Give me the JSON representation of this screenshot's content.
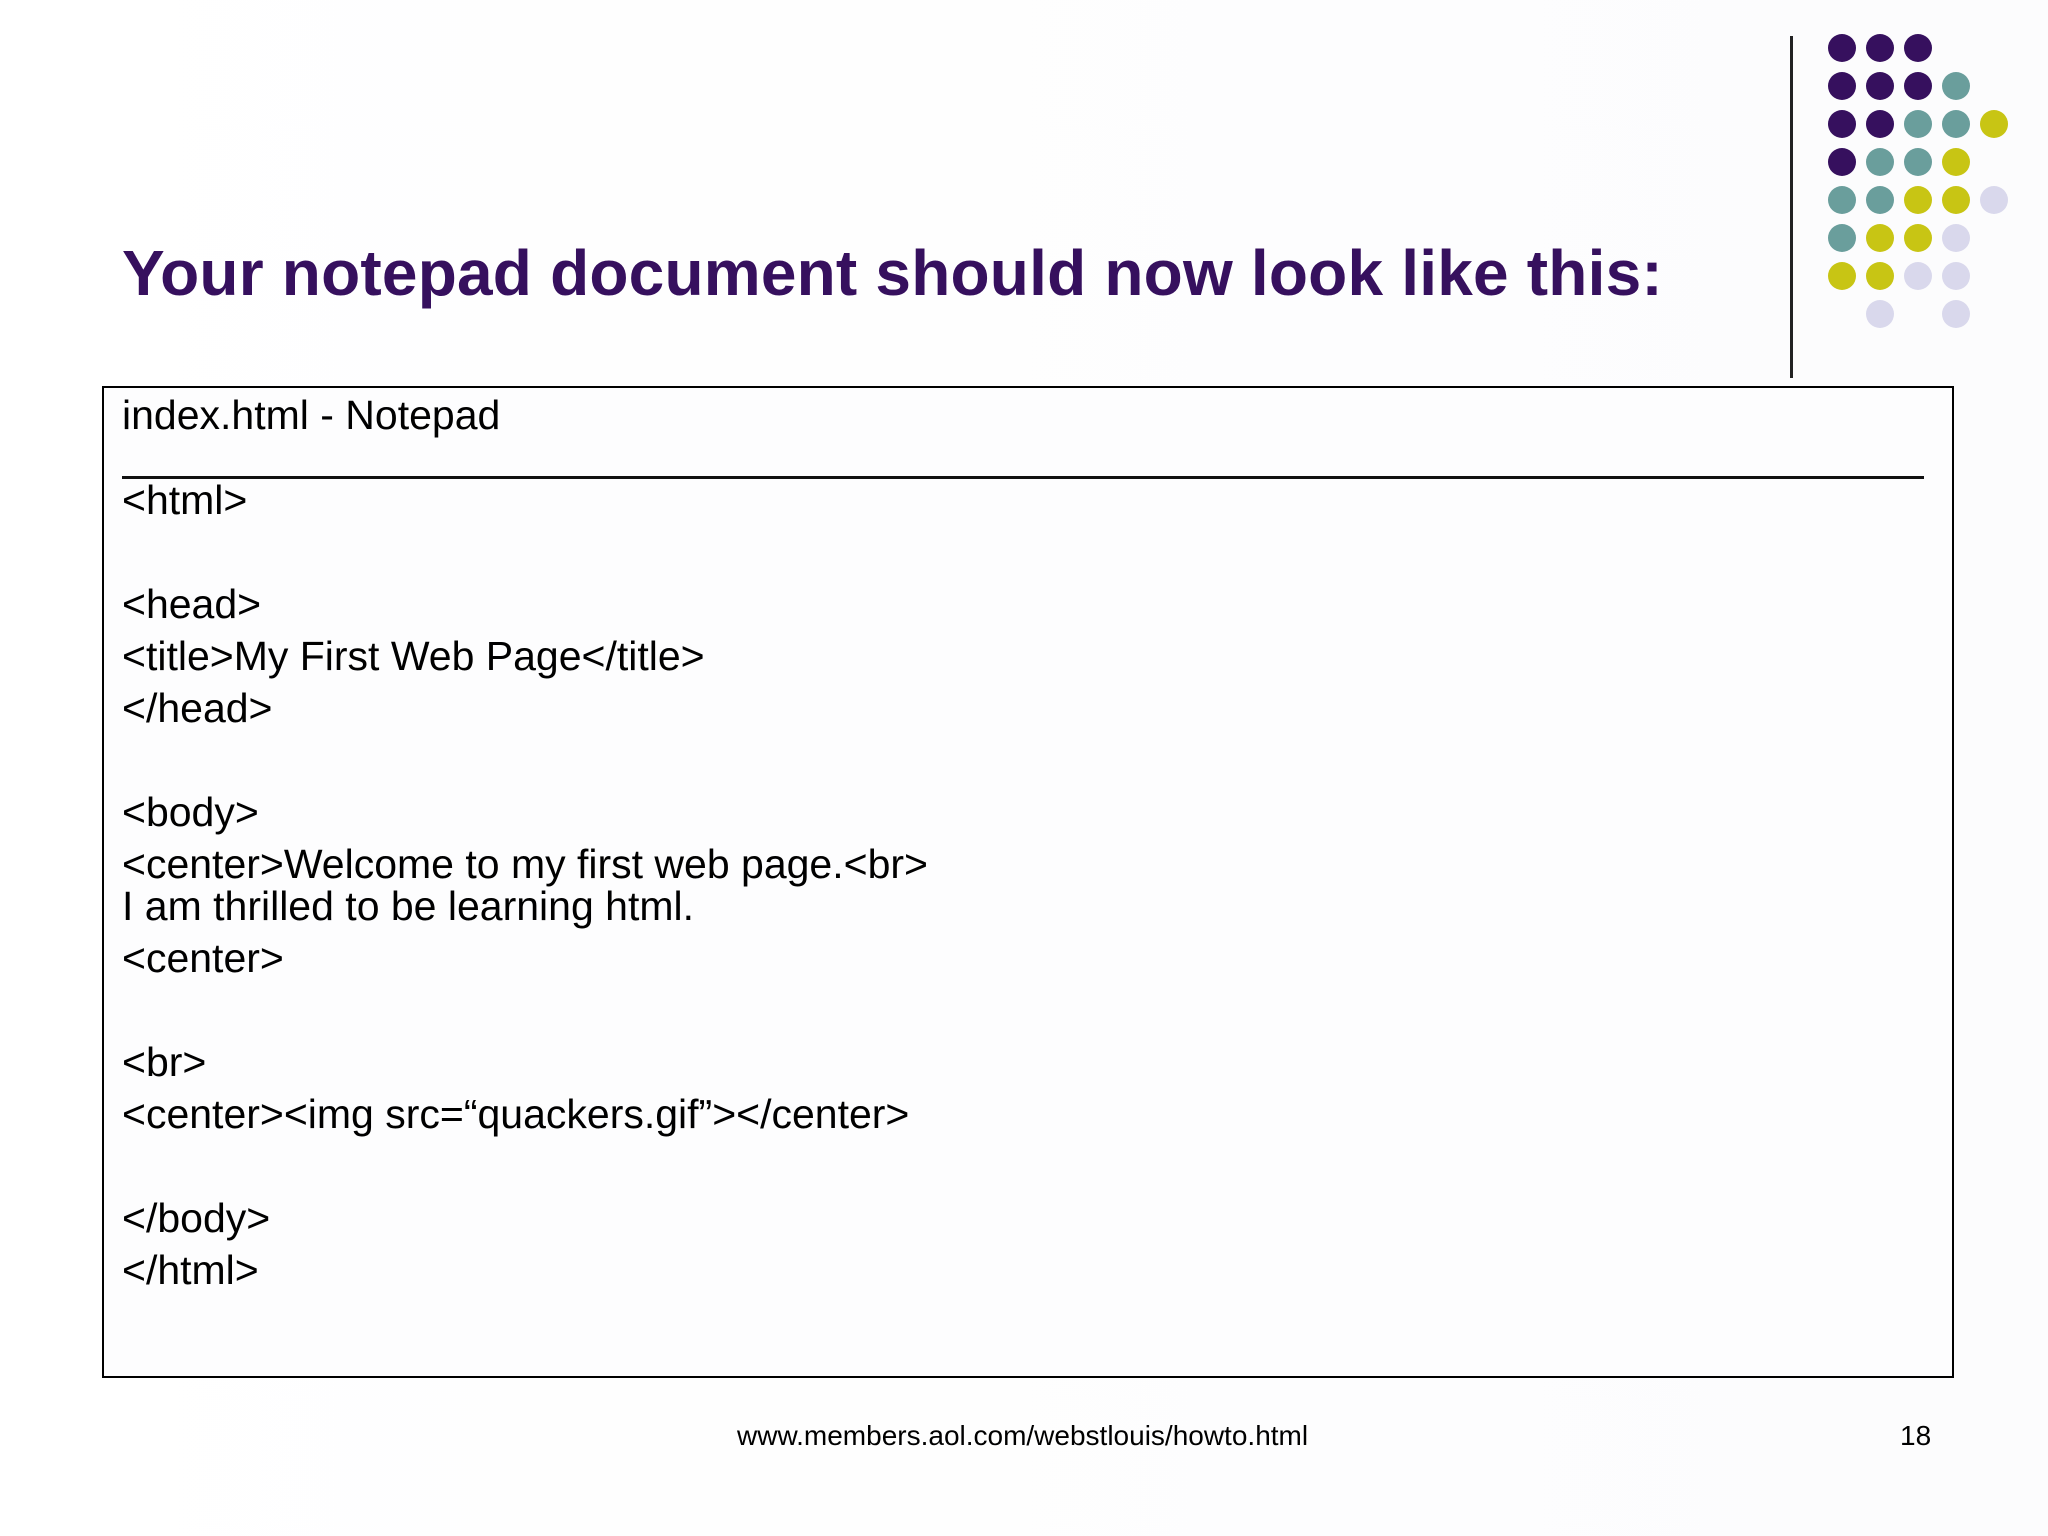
{
  "slide": {
    "title": "Your notepad document should now look like this:",
    "notepad": {
      "window_title": "index.html - Notepad",
      "lines": [
        "<html>",
        "",
        "<head>",
        "<title>My First Web Page</title>",
        "</head>",
        "",
        "<body>",
        "<center>Welcome to my first web page.<br>",
        "I am thrilled to be learning html.",
        "<center>",
        "",
        "<br>",
        "<center><img src=“quackers.gif”></center>",
        "",
        "</body>",
        "</html>"
      ]
    },
    "footer": {
      "url": "www.members.aol.com/webstlouis/howto.html",
      "page_number": "18"
    }
  },
  "colors": {
    "title": "#36105e",
    "dot_purple": "#36105e",
    "dot_teal": "#6a9e9c",
    "dot_olive": "#c8c514",
    "dot_lavender": "#d9d8ec"
  }
}
